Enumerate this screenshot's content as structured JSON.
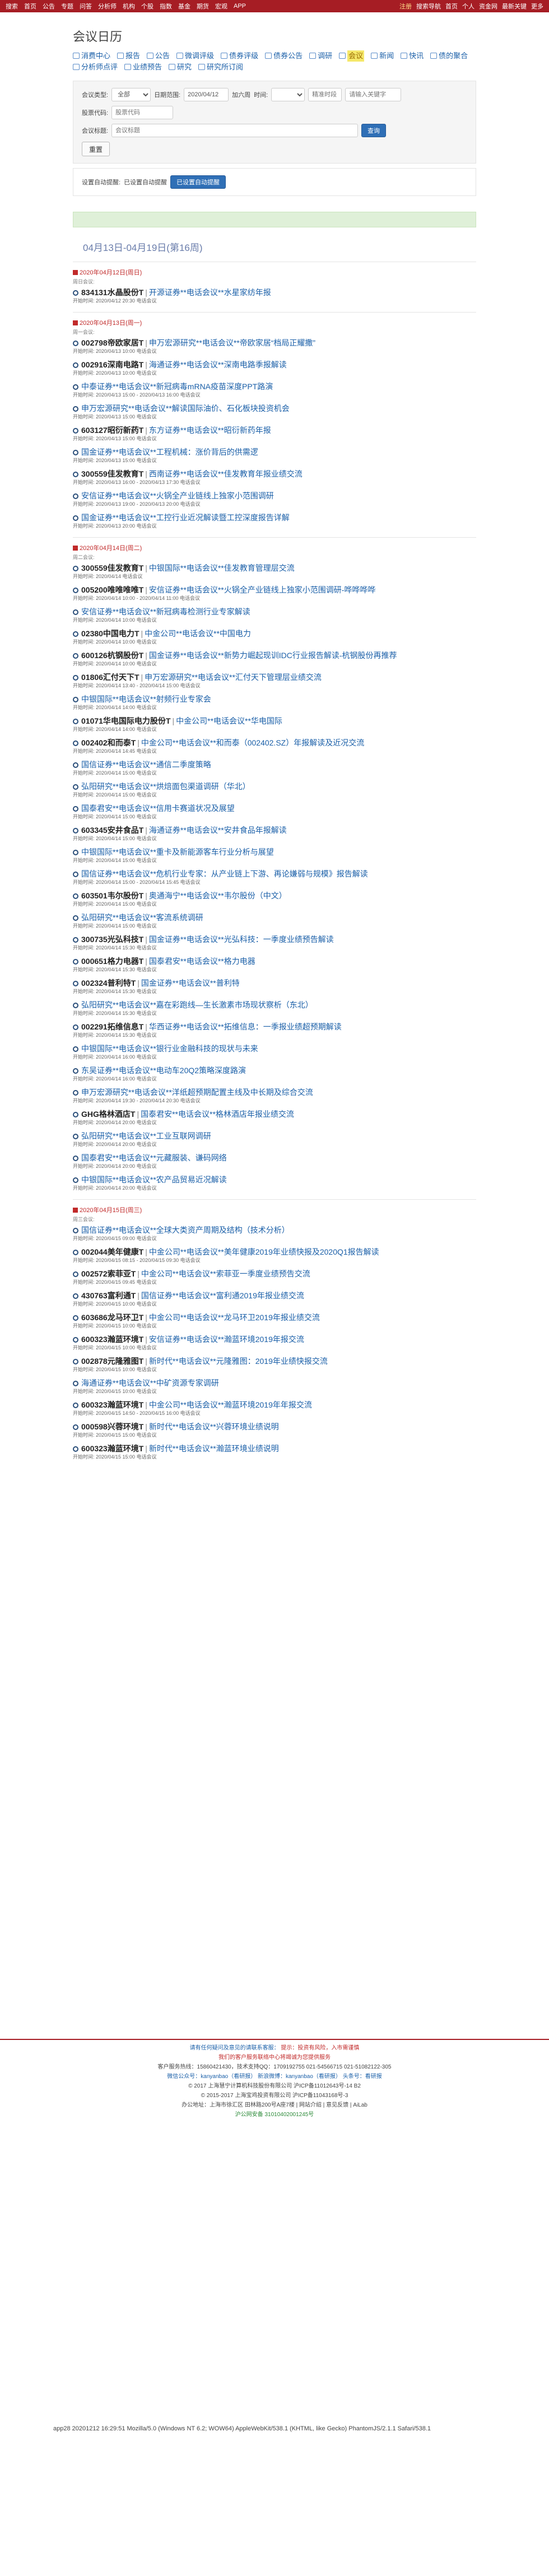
{
  "topnav": {
    "left": [
      "搜索",
      "首页",
      "公告",
      "专题",
      "问答",
      "分析师",
      "机构",
      "个股",
      "指数",
      "基金",
      "期货",
      "宏观",
      "APP"
    ],
    "right": [
      "注册",
      "搜索导航",
      "首页",
      "个人",
      "资金网",
      "最新关键",
      "更多"
    ]
  },
  "page": {
    "title": "会议日历"
  },
  "links": [
    "消费中心",
    "报告",
    "公告",
    "微调评级",
    "债券评级",
    "债券公告",
    "调研",
    "会议",
    "新闻",
    "快讯",
    "债的聚合",
    "分析师点评",
    "业绩预告",
    "研究",
    "研究所订阅"
  ],
  "filter": {
    "type_label": "会议类型:",
    "type_value": "全部",
    "date_label": "日期范围:",
    "date_value": "2020/04/12",
    "days_label": "加六周",
    "time_label": "时间:",
    "time_placeholder": "精准时段",
    "kw_label": "关键字:",
    "kw_placeholder": "请输入关键字",
    "code_label": "股票代码:",
    "code_placeholder": "股票代码",
    "search_label": "会议标题:",
    "search_placeholder": "会议标题",
    "search_btn": "查询",
    "reset_btn": "重置"
  },
  "settings": {
    "label": "设置自动提醒:",
    "info": "已设置自动提醒",
    "btn": "已设置自动提醒"
  },
  "range": "04月13日-04月19日(第16周)",
  "days": [
    {
      "head": "2020年04月12日(周日)",
      "sub": "周日会议:",
      "events": [
        {
          "stock": "834131水晶股份",
          "tag": "T",
          "content": "开源证券**电话会议**水星家纺年报",
          "meta": "开始时间: 2020/04/12 20:30 电话会议"
        }
      ]
    },
    {
      "head": "2020年04月13日(周一)",
      "sub": "周一会议:",
      "events": [
        {
          "stock": "002798帝欧家居",
          "tag": "T",
          "content": "申万宏源研究**电话会议**帝欧家居“档局正耀撒”",
          "meta": "开始时间: 2020/04/13 10:00 电话会议"
        },
        {
          "stock": "002916深南电路",
          "tag": "T",
          "content": "海通证券**电话会议**深南电路季报解读",
          "meta": "开始时间: 2020/04/13 10:00 电话会议"
        },
        {
          "stock": "",
          "tag": "",
          "content": "中泰证券**电话会议**新冠病毒mRNA疫苗深度PPT路演",
          "meta": "开始时间: 2020/04/13 15:00 - 2020/04/13 16:00 电话会议"
        },
        {
          "stock": "",
          "tag": "",
          "content": "申万宏源研究**电话会议**解读国际油价、石化板块投资机会",
          "meta": "开始时间: 2020/04/13 15:00 电话会议"
        },
        {
          "stock": "603127昭衍新药",
          "tag": "T",
          "content": "东方证券**电话会议**昭衍新药年报",
          "meta": "开始时间: 2020/04/13 15:00 电话会议"
        },
        {
          "stock": "",
          "tag": "",
          "content": "国金证券**电话会议**工程机械：涨价背后的供需逻",
          "meta": "开始时间: 2020/04/13 15:00 电话会议"
        },
        {
          "stock": "300559佳发教育",
          "tag": "T",
          "content": "西南证券**电话会议**佳发教育年报业绩交流",
          "meta": "开始时间: 2020/04/13 16:00 - 2020/04/13 17:30 电话会议"
        },
        {
          "stock": "",
          "tag": "",
          "content": "安信证券**电话会议**火锅全产业链线上独家小范围调研",
          "meta": "开始时间: 2020/04/13 19:00 - 2020/04/13 20:00 电话会议"
        },
        {
          "stock": "",
          "tag": "",
          "content": "国金证券**电话会议**工控行业近况解读暨工控深度报告详解",
          "meta": "开始时间: 2020/04/13 20:00 电话会议"
        }
      ]
    },
    {
      "head": "2020年04月14日(周二)",
      "sub": "周二会议:",
      "events": [
        {
          "stock": "300559佳发教育",
          "tag": "T",
          "content": "中银国际**电话会议**佳发教育管理层交流",
          "meta": "开始时间: 2020/04/14 电话会议"
        },
        {
          "stock": "005200唯唯唯唯",
          "tag": "T",
          "content": "安信证券**电话会议**火锅全产业链线上独家小范围调研-哗哗哗哗",
          "meta": "开始时间: 2020/04/14 10:00 - 2020/04/14 11:00 电话会议"
        },
        {
          "stock": "",
          "tag": "",
          "content": "安信证券**电话会议**新冠病毒检测行业专家解读",
          "meta": "开始时间: 2020/04/14 10:00 电话会议"
        },
        {
          "stock": "02380中国电力",
          "tag": "T",
          "content": "中金公司**电话会议**中国电力",
          "meta": "开始时间: 2020/04/14 10:00 电话会议"
        },
        {
          "stock": "600126杭钢股份",
          "tag": "T",
          "content": "国金证券**电话会议**新势力崛起现训IDC行业报告解读-杭钢股份再推荐",
          "meta": "开始时间: 2020/04/14 10:00 电话会议"
        },
        {
          "stock": "01806汇付天下",
          "tag": "T",
          "content": "申万宏源研究**电话会议**汇付天下管理层业绩交流",
          "meta": "开始时间: 2020/04/14 13:40 - 2020/04/14 15:00 电话会议"
        },
        {
          "stock": "",
          "tag": "",
          "content": "中银国际**电话会议**射频行业专家会",
          "meta": "开始时间: 2020/04/14 14:00 电话会议"
        },
        {
          "stock": "01071华电国际电力股份",
          "tag": "T",
          "content": "中金公司**电话会议**华电国际",
          "meta": "开始时间: 2020/04/14 14:00 电话会议"
        },
        {
          "stock": "002402和而泰",
          "tag": "T",
          "content": "中金公司**电话会议**和而泰（002402.SZ）年报解读及近况交流",
          "meta": "开始时间: 2020/04/14 14:45 电话会议"
        },
        {
          "stock": "",
          "tag": "",
          "content": "国信证券**电话会议**通信二季度策略",
          "meta": "开始时间: 2020/04/14 15:00 电话会议"
        },
        {
          "stock": "",
          "tag": "",
          "content": "弘阳研究**电话会议**烘焙面包渠道调研（华北）",
          "meta": "开始时间: 2020/04/14 15:00 电话会议"
        },
        {
          "stock": "",
          "tag": "",
          "content": "国泰君安**电话会议**信用卡赛道状况及展望",
          "meta": "开始时间: 2020/04/14 15:00 电话会议"
        },
        {
          "stock": "603345安井食品",
          "tag": "T",
          "content": "海通证券**电话会议**安井食品年报解读",
          "meta": "开始时间: 2020/04/14 15:00 电话会议"
        },
        {
          "stock": "",
          "tag": "",
          "content": "中银国际**电话会议**重卡及新能源客车行业分析与展望",
          "meta": "开始时间: 2020/04/14 15:00 电话会议"
        },
        {
          "stock": "",
          "tag": "",
          "content": "国信证券**电话会议**危机行业专家：从产业链上下游、再论嫌弱与规模》报告解读",
          "meta": "开始时间: 2020/04/14 15:00 - 2020/04/14 15:45 电话会议"
        },
        {
          "stock": "603501韦尔股份",
          "tag": "T",
          "content": "奥通海宁**电话会议**韦尔股份（中文）",
          "meta": "开始时间: 2020/04/14 15:00 电话会议"
        },
        {
          "stock": "",
          "tag": "",
          "content": "弘阳研究**电话会议**客流系统调研",
          "meta": "开始时间: 2020/04/14 15:00 电话会议"
        },
        {
          "stock": "300735光弘科技",
          "tag": "T",
          "content": "国金证券**电话会议**光弘科技：一季度业绩预告解读",
          "meta": "开始时间: 2020/04/14 15:30 电话会议"
        },
        {
          "stock": "000651格力电器",
          "tag": "T",
          "content": "国泰君安**电话会议**格力电器",
          "meta": "开始时间: 2020/04/14 15:30 电话会议"
        },
        {
          "stock": "002324普利特",
          "tag": "T",
          "content": "国金证券**电话会议**普利特",
          "meta": "开始时间: 2020/04/14 15:30 电话会议"
        },
        {
          "stock": "",
          "tag": "",
          "content": "弘阳研究**电话会议**嘉在彩跑线—生长激素市场现状察析（东北）",
          "meta": "开始时间: 2020/04/14 15:30 电话会议"
        },
        {
          "stock": "002291拓维信息",
          "tag": "T",
          "content": "华西证券**电话会议**拓维信息：一季报业绩超预期解读",
          "meta": "开始时间: 2020/04/14 15:30 电话会议"
        },
        {
          "stock": "",
          "tag": "",
          "content": "中银国际**电话会议**银行业金融科技的现状与未来",
          "meta": "开始时间: 2020/04/14 16:00 电话会议"
        },
        {
          "stock": "",
          "tag": "",
          "content": "东吴证券**电话会议**电动车20Q2策略深度路演",
          "meta": "开始时间: 2020/04/14 16:00 电话会议"
        },
        {
          "stock": "",
          "tag": "",
          "content": "申万宏源研究**电话会议**洋纸超预期配置主线及中长期及综合交流",
          "meta": "开始时间: 2020/04/14 19:30 - 2020/04/14 20:30 电话会议"
        },
        {
          "stock": "GHG格林酒店",
          "tag": "T",
          "content": "国泰君安**电话会议**格林酒店年报业绩交流",
          "meta": "开始时间: 2020/04/14 20:00 电话会议"
        },
        {
          "stock": "",
          "tag": "",
          "content": "弘阳研究**电话会议**工业互联网调研",
          "meta": "开始时间: 2020/04/14 20:00 电话会议"
        },
        {
          "stock": "",
          "tag": "",
          "content": "国泰君安**电话会议**元藏服装、谦码网络",
          "meta": "开始时间: 2020/04/14 20:00 电话会议"
        },
        {
          "stock": "",
          "tag": "",
          "content": "中银国际**电话会议**农产品贸易近况解读",
          "meta": "开始时间: 2020/04/14 20:00 电话会议"
        }
      ]
    },
    {
      "head": "2020年04月15日(周三)",
      "sub": "周三会议:",
      "events": [
        {
          "stock": "",
          "tag": "",
          "content": "国信证券**电话会议**全球大类资产周期及结构（技术分析）",
          "meta": "开始时间: 2020/04/15 09:00 电话会议"
        },
        {
          "stock": "002044美年健康",
          "tag": "T",
          "content": "中金公司**电话会议**美年健康2019年业绩快报及2020Q1报告解读",
          "meta": "开始时间: 2020/04/15 08:15 - 2020/04/15 09:30 电话会议"
        },
        {
          "stock": "002572索菲亚",
          "tag": "T",
          "content": "中金公司**电话会议**索菲亚一季度业绩预告交流",
          "meta": "开始时间: 2020/04/15 09:45 电话会议"
        },
        {
          "stock": "430763富利通",
          "tag": "T",
          "content": "国信证券**电话会议**富利通2019年报业绩交流",
          "meta": "开始时间: 2020/04/15 10:00 电话会议"
        },
        {
          "stock": "603686龙马环卫",
          "tag": "T",
          "content": "中金公司**电话会议**龙马环卫2019年报业绩交流",
          "meta": "开始时间: 2020/04/15 10:00 电话会议"
        },
        {
          "stock": "600323瀚蓝环境",
          "tag": "T",
          "content": "安信证券**电话会议**瀚蓝环境2019年报交流",
          "meta": "开始时间: 2020/04/15 10:00 电话会议"
        },
        {
          "stock": "002878元隆雅图",
          "tag": "T",
          "content": "新时代**电话会议**元隆雅图：2019年业绩快报交流",
          "meta": "开始时间: 2020/04/15 10:00 电话会议"
        },
        {
          "stock": "",
          "tag": "",
          "content": "海通证券**电话会议**中矿资源专家调研",
          "meta": "开始时间: 2020/04/15 10:00 电话会议"
        },
        {
          "stock": "600323瀚蓝环境",
          "tag": "T",
          "content": "中金公司**电话会议**瀚蓝环境2019年年报交流",
          "meta": "开始时间: 2020/04/15 14:50 - 2020/04/15 16:00 电话会议"
        },
        {
          "stock": "000598兴蓉环境",
          "tag": "T",
          "content": "新时代**电话会议**兴蓉环境业绩说明",
          "meta": "开始时间: 2020/04/15 15:00 电话会议"
        },
        {
          "stock": "600323瀚蓝环境",
          "tag": "T",
          "content": "新时代**电话会议**瀚蓝环境业绩说明",
          "meta": "开始时间: 2020/04/15 15:00 电话会议"
        }
      ]
    }
  ],
  "footer": {
    "l1": "请有任何疑问及意见的请联系客服：",
    "l1b": "提示：投资有风险，入市需谨慎",
    "l2": "我们的客户服务联络中心将竭诚为您提供服务",
    "l3": "客户服务热线：15860421430，技术支持QQ：1709192755 021-54566715 021-51082122-305",
    "l4": "微信公众号：kanyanbao（看研报） 新浪微博：kanyanbao（看研报） 头条号：看研报",
    "l5": "© 2017 上海慧宁计算机科技股份有限公司 沪ICP备11012643号-14 B2",
    "l6": "© 2015-2017 上海宝鸡投资有限公司 沪ICP备11043168号-3",
    "l7": "办公地址：上海市徐汇区 田林路200号A座7楼 | 网站介绍 | 意见反馈 | AiLab",
    "l8": "沪公网安备 31010402001245号"
  },
  "ua": "app28 20201212 16:29:51 Mozilla/5.0 (Windows NT 6.2; WOW64) AppleWebKit/538.1 (KHTML, like Gecko) PhantomJS/2.1.1 Safari/538.1"
}
